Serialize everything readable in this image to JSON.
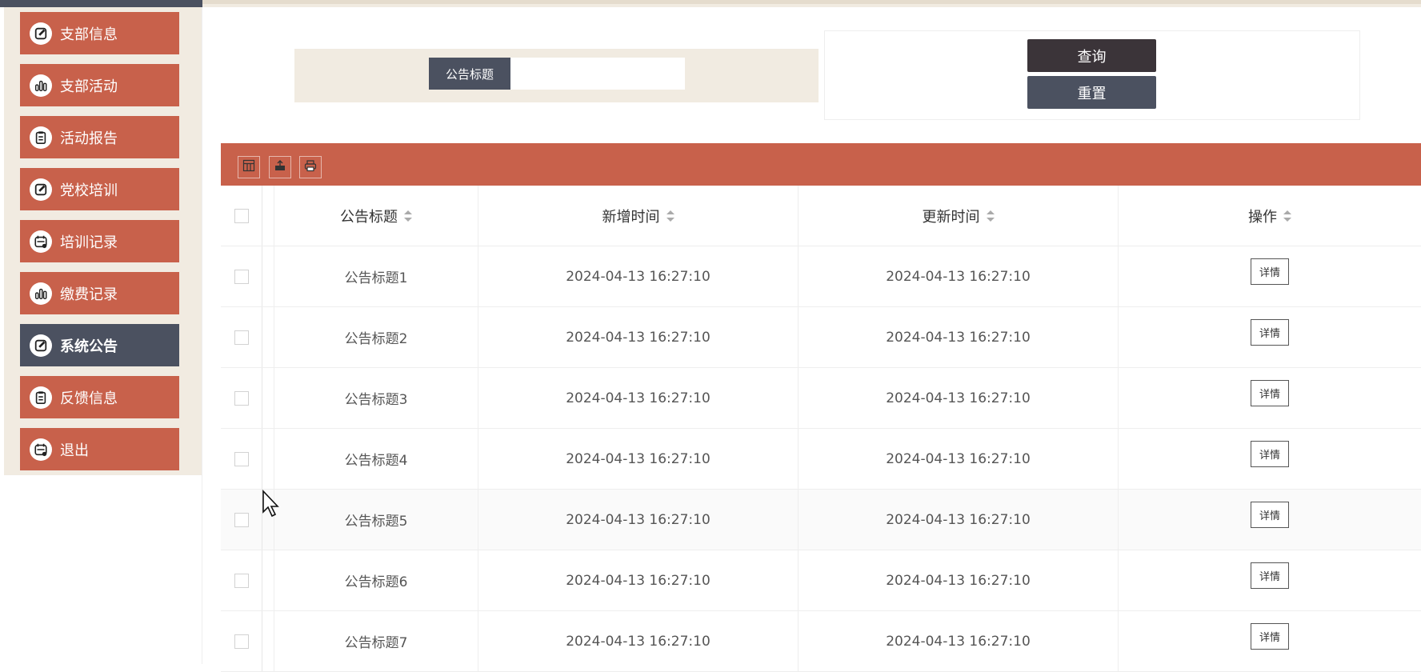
{
  "sidebar": {
    "items": [
      {
        "label": "支部信息",
        "icon": "edit-icon"
      },
      {
        "label": "支部活动",
        "icon": "bar-chart-icon"
      },
      {
        "label": "活动报告",
        "icon": "clipboard-icon"
      },
      {
        "label": "党校培训",
        "icon": "edit-icon"
      },
      {
        "label": "培训记录",
        "icon": "calendar-icon"
      },
      {
        "label": "缴费记录",
        "icon": "bar-chart-icon"
      },
      {
        "label": "系统公告",
        "icon": "edit-icon",
        "active": true
      },
      {
        "label": "反馈信息",
        "icon": "clipboard-icon"
      },
      {
        "label": "退出",
        "icon": "calendar-icon"
      }
    ]
  },
  "search": {
    "label": "公告标题",
    "value": "",
    "placeholder": ""
  },
  "buttons": {
    "query": "查询",
    "reset": "重置"
  },
  "toolbar": {
    "icons": [
      "columns-icon",
      "export-icon",
      "print-icon"
    ]
  },
  "table": {
    "headers": {
      "title": "公告标题",
      "added": "新增时间",
      "updated": "更新时间",
      "action": "操作"
    },
    "detail_label": "详情",
    "rows": [
      {
        "title": "公告标题1",
        "added": "2024-04-13 16:27:10",
        "updated": "2024-04-13 16:27:10"
      },
      {
        "title": "公告标题2",
        "added": "2024-04-13 16:27:10",
        "updated": "2024-04-13 16:27:10"
      },
      {
        "title": "公告标题3",
        "added": "2024-04-13 16:27:10",
        "updated": "2024-04-13 16:27:10"
      },
      {
        "title": "公告标题4",
        "added": "2024-04-13 16:27:10",
        "updated": "2024-04-13 16:27:10"
      },
      {
        "title": "公告标题5",
        "added": "2024-04-13 16:27:10",
        "updated": "2024-04-13 16:27:10"
      },
      {
        "title": "公告标题6",
        "added": "2024-04-13 16:27:10",
        "updated": "2024-04-13 16:27:10"
      },
      {
        "title": "公告标题7",
        "added": "2024-04-13 16:27:10",
        "updated": "2024-04-13 16:27:10"
      }
    ]
  },
  "colors": {
    "accent": "#c8614b",
    "dark": "#4b5160",
    "beige": "#f1ebe1",
    "query_button": "#3b3439"
  }
}
